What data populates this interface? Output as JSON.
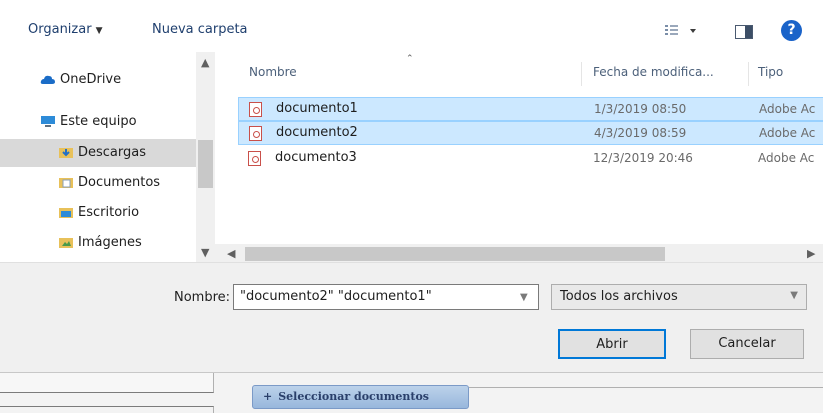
{
  "toolbar": {
    "organizar": "Organizar",
    "organizar_caret": "▼",
    "nueva_carpeta": "Nueva carpeta",
    "help": "?"
  },
  "nav": {
    "items": [
      {
        "label": "OneDrive",
        "icon": "onedrive-cloud-icon"
      },
      {
        "label": "Este equipo",
        "icon": "computer-icon"
      },
      {
        "label": "Descargas",
        "icon": "downloads-folder-icon"
      },
      {
        "label": "Documentos",
        "icon": "documents-folder-icon"
      },
      {
        "label": "Escritorio",
        "icon": "desktop-folder-icon"
      },
      {
        "label": "Imágenes",
        "icon": "pictures-folder-icon"
      }
    ],
    "selected": "Descargas"
  },
  "columns": {
    "name": "Nombre",
    "date": "Fecha de modifica...",
    "type": "Tipo"
  },
  "files": [
    {
      "name": "documento1",
      "date": "1/3/2019 08:50",
      "type": "Adobe Ac",
      "selected": true
    },
    {
      "name": "documento2",
      "date": "4/3/2019 08:59",
      "type": "Adobe Ac",
      "selected": true
    },
    {
      "name": "documento3",
      "date": "12/3/2019 20:46",
      "type": "Adobe Ac",
      "selected": false
    }
  ],
  "footer": {
    "name_label": "Nombre:",
    "name_value": "\"documento2\" \"documento1\"",
    "file_type": "Todos los archivos",
    "open_label": "Abrir",
    "cancel_label": "Cancelar"
  },
  "underlying": {
    "select_docs_label": "Seleccionar documentos",
    "select_docs_plus": "+"
  },
  "colors": {
    "selection_bg": "#cce8ff",
    "selection_border": "#99d1ff",
    "accent": "#0078d7",
    "help_blue": "#1a63c9"
  }
}
